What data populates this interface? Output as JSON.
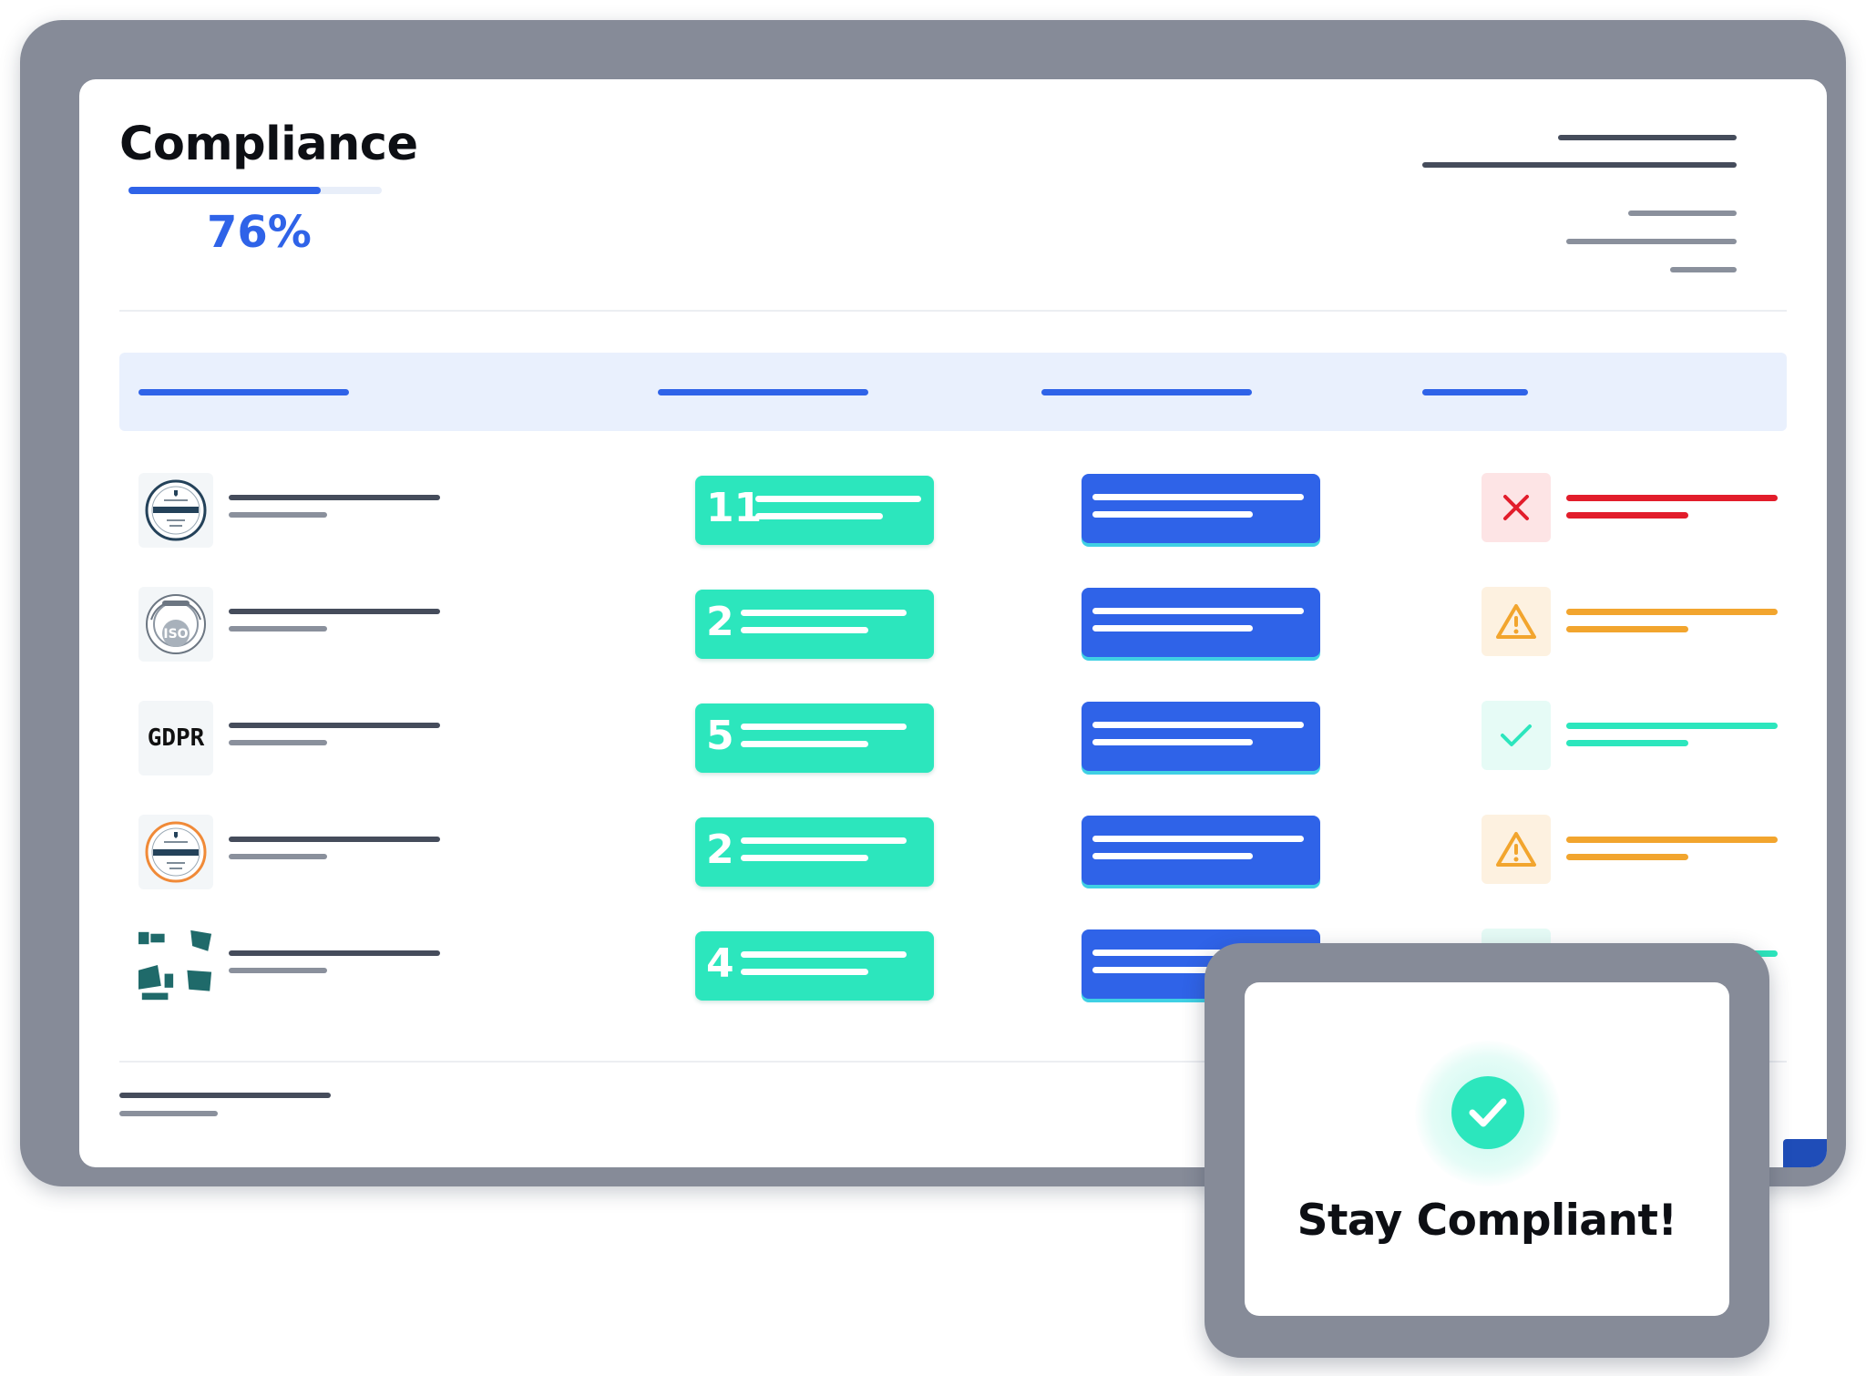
{
  "header": {
    "title": "Compliance",
    "progress_percent": 76,
    "progress_label": "76%"
  },
  "colors": {
    "accent": "#2f63e8",
    "teal": "#2ce6bd",
    "error": "#e21d2b",
    "warning": "#f2a52e",
    "frame": "#868b98"
  },
  "rows": [
    {
      "logo": "cis-controls-badge-icon",
      "count": "11",
      "status": "error",
      "status_icon": "close-icon"
    },
    {
      "logo": "iso-27001-badge-icon",
      "count": "2",
      "status": "warning",
      "status_icon": "warning-icon"
    },
    {
      "logo_text": "GDPR",
      "count": "5",
      "status": "ok",
      "status_icon": "check-icon"
    },
    {
      "logo": "nist-badge-icon",
      "count": "2",
      "status": "warning",
      "status_icon": "warning-icon"
    },
    {
      "logo": "cisa-logo-icon",
      "count": "4",
      "status": "ok",
      "status_icon": "check-icon"
    }
  ],
  "popup": {
    "message": "Stay Compliant!",
    "icon": "check-circle-icon"
  }
}
